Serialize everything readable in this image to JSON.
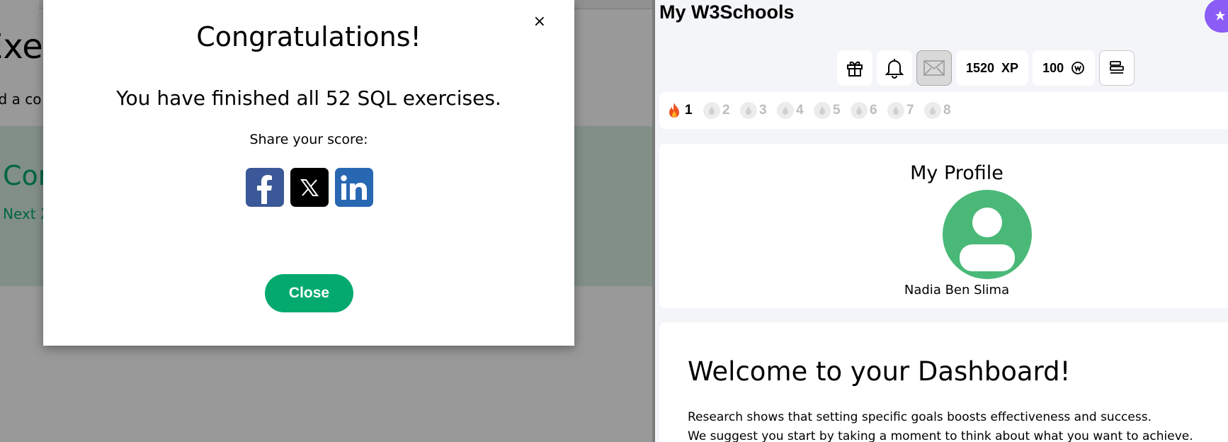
{
  "background": {
    "heading": "Exer",
    "description": "ld a co",
    "correct_title": "Cor",
    "next_link": "Next X"
  },
  "modal": {
    "close_glyph": "×",
    "title": "Congratulations!",
    "message": "You have finished all 52 SQL exercises.",
    "share_label": "Share your score:",
    "share_icons": [
      "facebook-icon",
      "x-icon",
      "linkedin-icon"
    ],
    "close_button": "Close"
  },
  "dashboard": {
    "app_title": "My W3Schools",
    "toolbar": {
      "icons": [
        "gift-icon",
        "bell-icon",
        "mail-icon",
        "sidebar-icon"
      ],
      "xp_value": "1520",
      "xp_label": "XP",
      "coins_value": "100"
    },
    "streak": {
      "days": [
        "1",
        "2",
        "3",
        "4",
        "5",
        "6",
        "7",
        "8"
      ],
      "completed_days": 1
    },
    "profile": {
      "title": "My Profile",
      "name": "Nadia Ben Slima"
    },
    "welcome": {
      "title": "Welcome to your Dashboard!",
      "paragraph_1": "Research shows that setting specific goals boosts effectiveness and success.",
      "paragraph_2": "We suggest you start by taking a moment to think about what you want to achieve."
    }
  },
  "colors": {
    "accent_green": "#04AA6D",
    "avatar_green": "#4ab978",
    "facebook": "#3b5998",
    "linkedin": "#2867b2",
    "purple": "#8b5cf6"
  }
}
